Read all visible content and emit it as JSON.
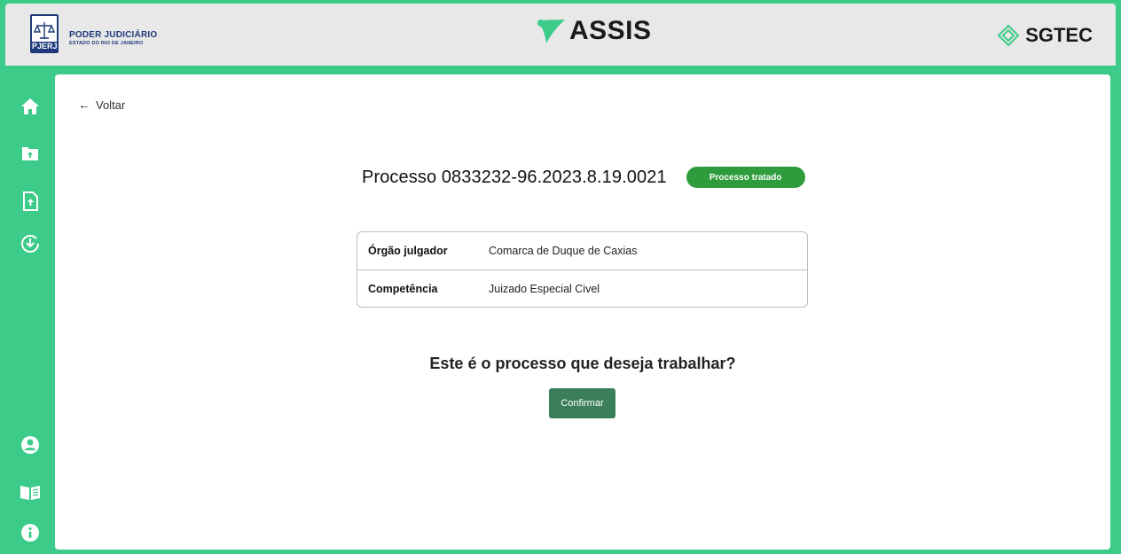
{
  "header": {
    "left_brand": {
      "line1": "PODER JUDICIÁRIO",
      "line2": "ESTADO DO RIO DE JANEIRO",
      "logo_tag": "PJERJ"
    },
    "center_brand": {
      "name": "ASSIS"
    },
    "right_brand": {
      "name": "SGTEC"
    }
  },
  "sidebar": {
    "items": [
      {
        "icon": "home-icon"
      },
      {
        "icon": "folder-upload-icon"
      },
      {
        "icon": "file-upload-icon"
      },
      {
        "icon": "download-circle-icon"
      },
      {
        "icon": "user-circle-icon"
      },
      {
        "icon": "book-icon"
      },
      {
        "icon": "info-icon"
      }
    ]
  },
  "main": {
    "back_label": "Voltar",
    "process_title": "Processo 0833232-96.2023.8.19.0021",
    "status_badge": "Processo tratado",
    "info": [
      {
        "label": "Órgão julgador",
        "value": "Comarca de Duque de Caxias"
      },
      {
        "label": "Competência",
        "value": "Juizado Especial Civel"
      }
    ],
    "question": "Este é o processo que deseja trabalhar?",
    "confirm_label": "Confirmar"
  },
  "colors": {
    "accent_green": "#3dcb8a",
    "badge_green": "#2e9c3c",
    "button_green": "#3b7f5a",
    "header_bg": "#e8e8e8"
  }
}
